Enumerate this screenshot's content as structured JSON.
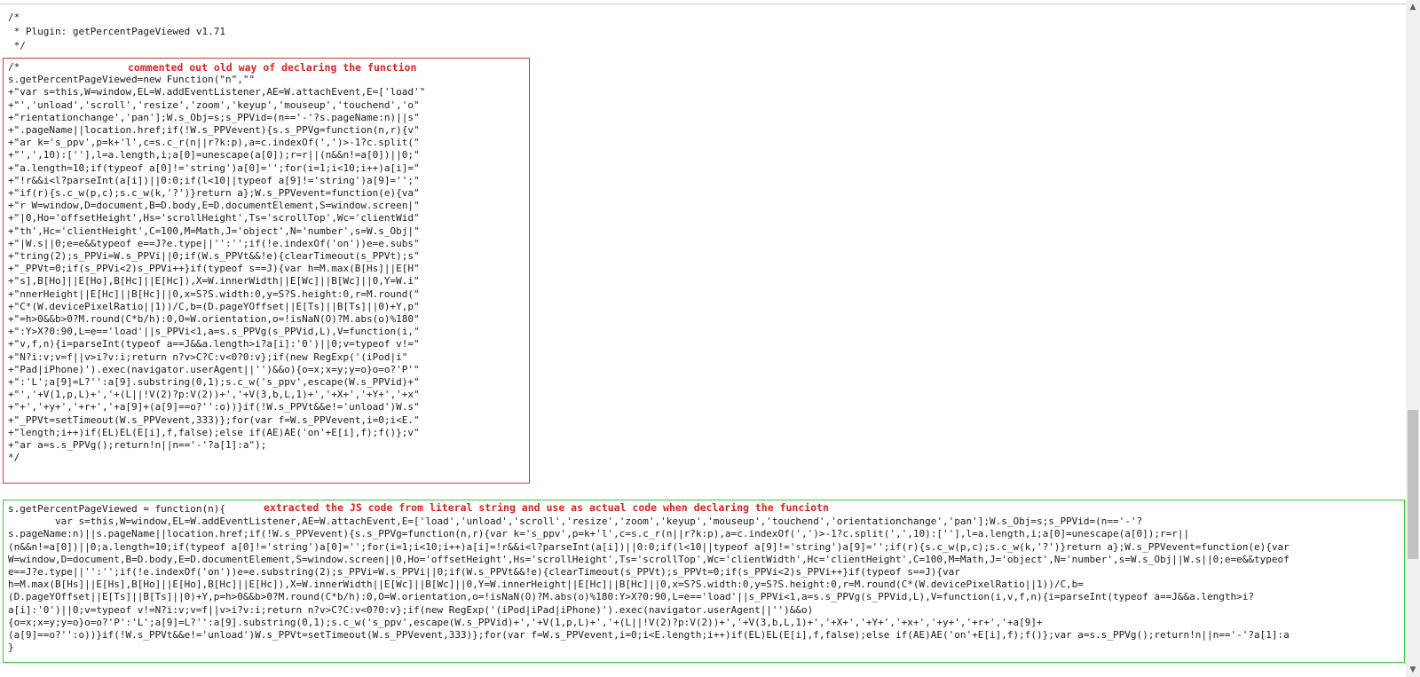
{
  "header_comment": "/*\n * Plugin: getPercentPageViewed v1.71\n */",
  "old_block": {
    "note": "commented out old way of declaring the function",
    "code": "/*\ns.getPercentPageViewed=new Function(\"n\",\"\"\n+\"var s=this,W=window,EL=W.addEventListener,AE=W.attachEvent,E=['load'\"\n+\"','unload','scroll','resize','zoom','keyup','mouseup','touchend','o\"\n+\"rientationchange','pan'];W.s_Obj=s;s_PPVid=(n=='-'?s.pageName:n)||s\"\n+\".pageName||location.href;if(!W.s_PPVevent){s.s_PPVg=function(n,r){v\"\n+\"ar k='s_ppv',p=k+'l',c=s.c_r(n||r?k:p),a=c.indexOf(',')>-1?c.split(\"\n+\"',',10):[''],l=a.length,i;a[0]=unescape(a[0]);r=r||(n&&n!=a[0])||0;\"\n+\"a.length=10;if(typeof a[0]!='string')a[0]='';for(i=1;i<10;i++)a[i]=\"\n+\"!r&&i<l?parseInt(a[i])||0:0;if(l<10||typeof a[9]!='string')a[9]='';\"\n+\"if(r){s.c_w(p,c);s.c_w(k,'?')}return a};W.s_PPVevent=function(e){va\"\n+\"r W=window,D=document,B=D.body,E=D.documentElement,S=window.screen|\"\n+\"|0,Ho='offsetHeight',Hs='scrollHeight',Ts='scrollTop',Wc='clientWid\"\n+\"th',Hc='clientHeight',C=100,M=Math,J='object',N='number',s=W.s_Obj|\"\n+\"|W.s||0;e=e&&typeof e==J?e.type||'':'';if(!e.indexOf('on'))e=e.subs\"\n+\"tring(2);s_PPVi=W.s_PPVi||0;if(W.s_PPVt&&!e){clearTimeout(s_PPVt);s\"\n+\"_PPVt=0;if(s_PPVi<2)s_PPVi++}if(typeof s==J){var h=M.max(B[Hs]||E[H\"\n+\"s],B[Ho]||E[Ho],B[Hc]||E[Hc]),X=W.innerWidth||E[Wc]||B[Wc]||0,Y=W.i\"\n+\"nnerHeight||E[Hc]||B[Hc]||0,x=S?S.width:0,y=S?S.height:0,r=M.round(\"\n+\"C*(W.devicePixelRatio||1))/C,b=(D.pageYOffset||E[Ts]||B[Ts]||0)+Y,p\"\n+\"=h>0&&b>0?M.round(C*b/h):0,O=W.orientation,o=!isNaN(O)?M.abs(o)%180\"\n+\":Y>X?0:90,L=e=='load'||s_PPVi<1,a=s.s_PPVg(s_PPVid,L),V=function(i,\"\n+\"v,f,n){i=parseInt(typeof a==J&&a.length>i?a[i]:'0')||0;v=typeof v!=\"\n+\"N?i:v;v=f||v>i?v:i;return n?v>C?C:v<0?0:v};if(new RegExp('(iPod|i\"\n+\"Pad|iPhone)').exec(navigator.userAgent||'')&&o){o=x;x=y;y=o}o=o?'P'\"\n+\":'L';a[9]=L?'':a[9].substring(0,1);s.c_w('s_ppv',escape(W.s_PPVid)+\"\n+\"','+V(1,p,L)+','+(L||!V(2)?p:V(2))+','+V(3,b,L,1)+','+X+','+Y+','+x\"\n+\"+','+y+','+r+','+a[9]+(a[9]==o?'':o))}if(!W.s_PPVt&&e!='unload')W.s\"\n+\"_PPVt=setTimeout(W.s_PPVevent,333)};for(var f=W.s_PPVevent,i=0;i<E.\"\n+\"length;i++)if(EL)EL(E[i],f,false);else if(AE)AE('on'+E[i],f);f()};v\"\n+\"ar a=s.s_PPVg();return!n||n=='-'?a[1]:a\");\n*/"
  },
  "new_block": {
    "note": "extracted the JS code from literal string and use as actual code when declaring the funciotn",
    "code": "s.getPercentPageViewed = function(n){\n        var s=this,W=window,EL=W.addEventListener,AE=W.attachEvent,E=['load','unload','scroll','resize','zoom','keyup','mouseup','touchend','orientationchange','pan'];W.s_Obj=s;s_PPVid=(n=='-'?\ns.pageName:n)||s.pageName||location.href;if(!W.s_PPVevent){s.s_PPVg=function(n,r){var k='s_ppv',p=k+'l',c=s.c_r(n||r?k:p),a=c.indexOf(',')>-1?c.split(',',10):[''],l=a.length,i;a[0]=unescape(a[0]);r=r||\n(n&&n!=a[0])||0;a.length=10;if(typeof a[0]!='string')a[0]='';for(i=1;i<10;i++)a[i]=!r&&i<l?parseInt(a[i])||0:0;if(l<10||typeof a[9]!='string')a[9]='';if(r){s.c_w(p,c);s.c_w(k,'?')}return a};W.s_PPVevent=function(e){var\nW=window,D=document,B=D.body,E=D.documentElement,S=window.screen||0,Ho='offsetHeight',Hs='scrollHeight',Ts='scrollTop',Wc='clientWidth',Hc='clientHeight',C=100,M=Math,J='object',N='number',s=W.s_Obj||W.s||0;e=e&&typeof\ne==J?e.type||'':'';if(!e.indexOf('on'))e=e.substring(2);s_PPVi=W.s_PPVi||0;if(W.s_PPVt&&!e){clearTimeout(s_PPVt);s_PPVt=0;if(s_PPVi<2)s_PPVi++}if(typeof s==J){var\nh=M.max(B[Hs]||E[Hs],B[Ho]||E[Ho],B[Hc]||E[Hc]),X=W.innerWidth||E[Wc]||B[Wc]||0,Y=W.innerHeight||E[Hc]||B[Hc]||0,x=S?S.width:0,y=S?S.height:0,r=M.round(C*(W.devicePixelRatio||1))/C,b=\n(D.pageYOffset||E[Ts]||B[Ts]||0)+Y,p=h>0&&b>0?M.round(C*b/h):0,O=W.orientation,o=!isNaN(O)?M.abs(o)%180:Y>X?0:90,L=e=='load'||s_PPVi<1,a=s.s_PPVg(s_PPVid,L),V=function(i,v,f,n){i=parseInt(typeof a==J&&a.length>i?\na[i]:'0')||0;v=typeof v!=N?i:v;v=f||v>i?v:i;return n?v>C?C:v<0?0:v};if(new RegExp('(iPod|iPad|iPhone)').exec(navigator.userAgent||'')&&o)\n{o=x;x=y;y=o}o=o?'P':'L';a[9]=L?'':a[9].substring(0,1);s.c_w('s_ppv',escape(W.s_PPVid)+','+V(1,p,L)+','+(L||!V(2)?p:V(2))+','+V(3,b,L,1)+','+X+','+Y+','+x+','+y+','+r+','+a[9]+\n(a[9]==o?'':o))}if(!W.s_PPVt&&e!='unload')W.s_PPVt=setTimeout(W.s_PPVevent,333)};for(var f=W.s_PPVevent,i=0;i<E.length;i++)if(EL)EL(E[i],f,false);else if(AE)AE('on'+E[i],f);f()};var a=s.s_PPVg();return!n||n=='-'?a[1]:a\n}"
  },
  "scrollbar": {
    "up_icon": "▲",
    "down_icon": "▼"
  },
  "colors": {
    "annotation": "#e02020",
    "old_box_border": "#e03030",
    "new_box_border": "#33cc33"
  }
}
